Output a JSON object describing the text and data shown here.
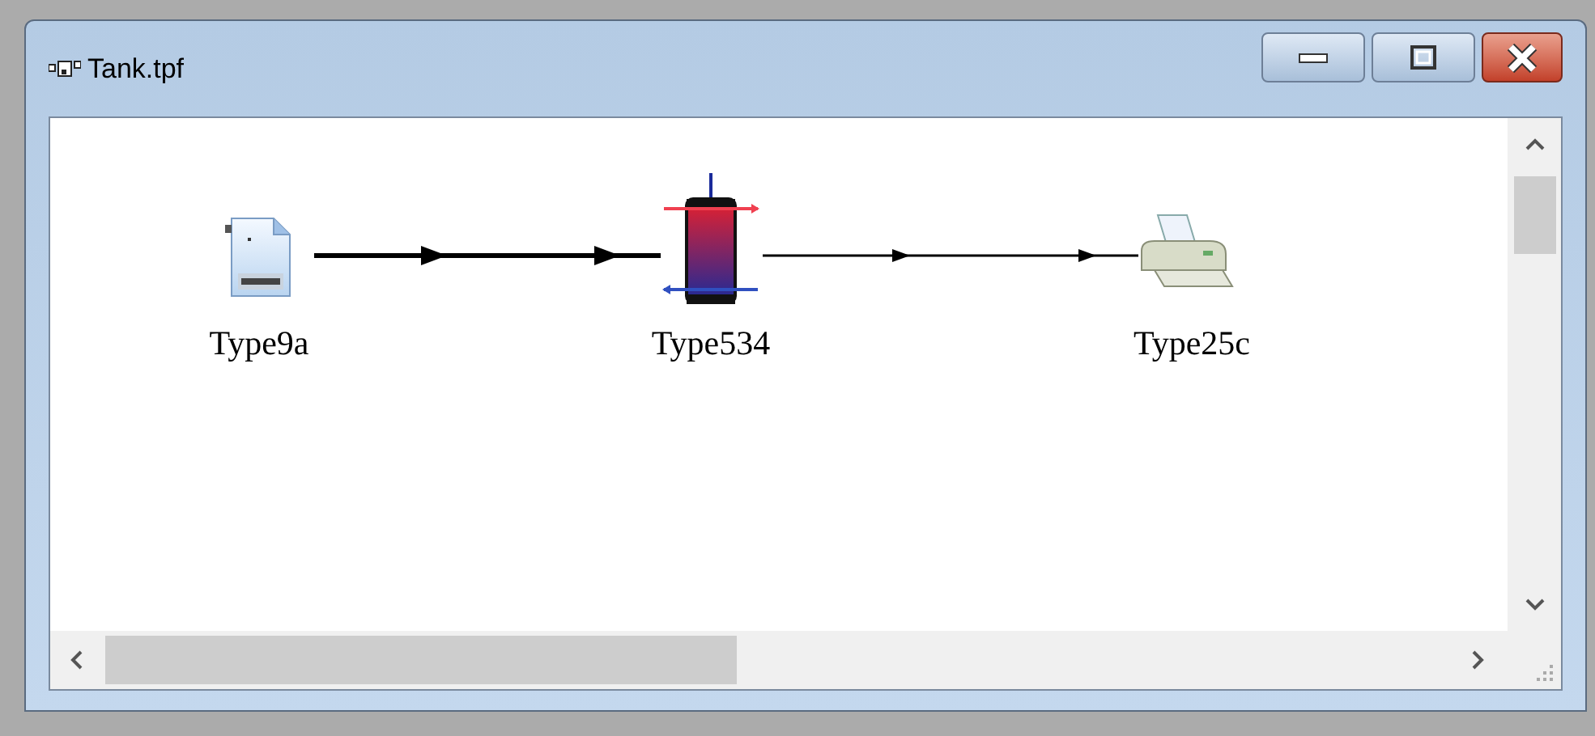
{
  "window": {
    "title": "Tank.tpf"
  },
  "nodes": [
    {
      "kind": "user-file",
      "label": "Type9a"
    },
    {
      "kind": "tank",
      "label": "Type534"
    },
    {
      "kind": "printer",
      "label": "Type25c"
    }
  ]
}
